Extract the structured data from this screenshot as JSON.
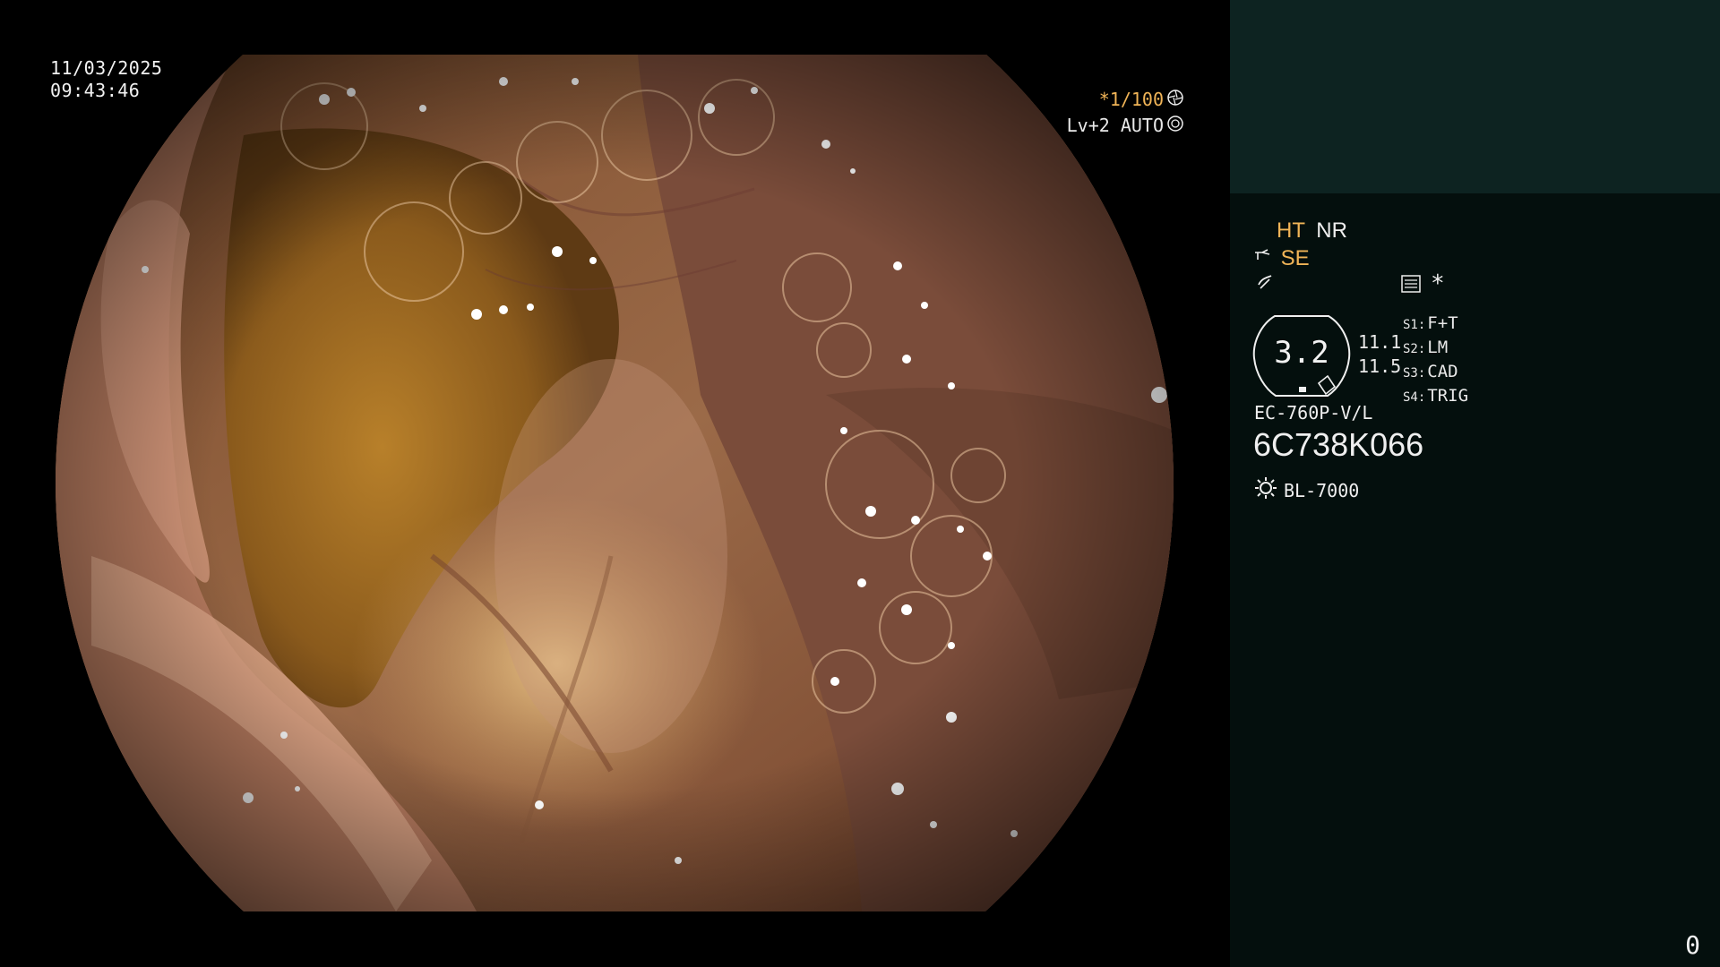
{
  "overlay": {
    "date": "11/03/2025",
    "time": "09:43:46",
    "shutter": "*1/100",
    "shutter_icon": "iris-icon",
    "level": "Lv+2 AUTO",
    "level_icon": "auto-iris-icon"
  },
  "panel": {
    "modes": {
      "ht": "HT",
      "nr": "NR",
      "se": "SE"
    },
    "zoom": "3.2",
    "side_values": [
      "11.1",
      "11.5"
    ],
    "switches": [
      {
        "key": "S1:",
        "label": "F+T"
      },
      {
        "key": "S2:",
        "label": "LM"
      },
      {
        "key": "S3:",
        "label": "CAD"
      },
      {
        "key": "S4:",
        "label": "TRIG"
      }
    ],
    "scope_model": "EC-760P-V/L",
    "scope_serial": "6C738K066",
    "light_source": "BL-7000",
    "asterisk": "*",
    "counter": "0"
  },
  "colors": {
    "panel_bg": "#040f0d",
    "panel_header_bg": "#0d2321",
    "accent_orange": "#f0b457",
    "text": "#efefef"
  }
}
